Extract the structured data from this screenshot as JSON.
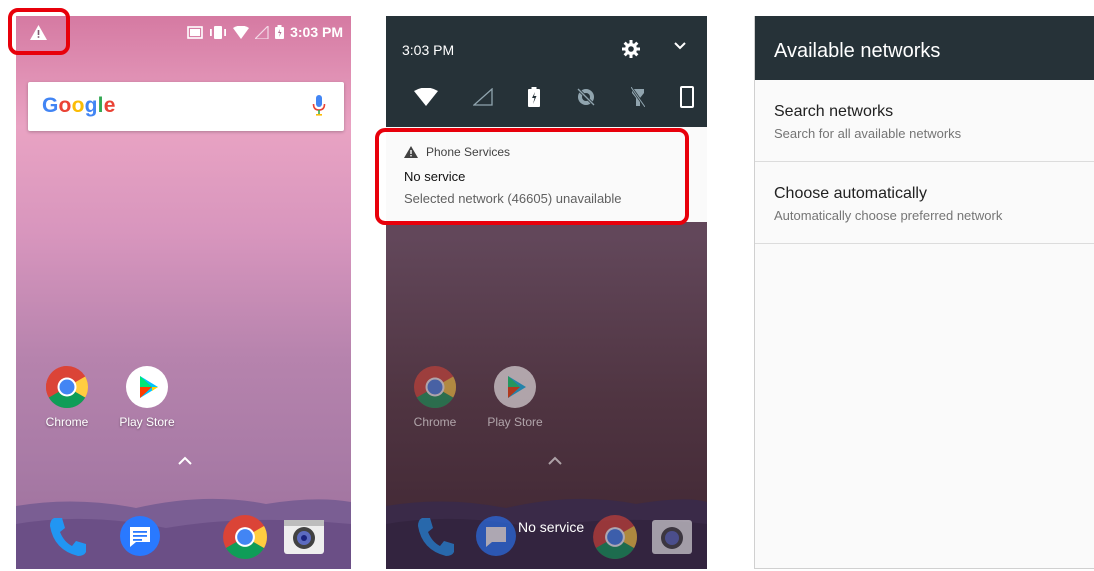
{
  "phone1": {
    "status_time": "3:03 PM",
    "search_logo": [
      "G",
      "o",
      "o",
      "g",
      "l",
      "e"
    ],
    "apps": [
      {
        "label": "Chrome"
      },
      {
        "label": "Play Store"
      }
    ],
    "dock_icons": [
      "phone-icon",
      "messages-icon",
      "chrome-icon",
      "camera-icon"
    ]
  },
  "phone2": {
    "shade_time": "3:03 PM",
    "quick_settings_icons": [
      "wifi-icon",
      "cellular-signal-icon",
      "battery-saver-icon",
      "do-not-disturb-icon",
      "flashlight-icon",
      "auto-rotate-icon"
    ],
    "notification": {
      "app_name": "Phone Services",
      "title": "No service",
      "text": "Selected network (46605) unavailable"
    },
    "apps": [
      {
        "label": "Chrome"
      },
      {
        "label": "Play Store"
      }
    ],
    "dock_label": "No service"
  },
  "phone3": {
    "title": "Available networks",
    "items": [
      {
        "title": "Search networks",
        "summary": "Search for all available networks"
      },
      {
        "title": "Choose automatically",
        "summary": "Automatically choose preferred network"
      }
    ]
  },
  "colors": {
    "highlight": "#e8000b",
    "dark_bar": "#263238"
  }
}
